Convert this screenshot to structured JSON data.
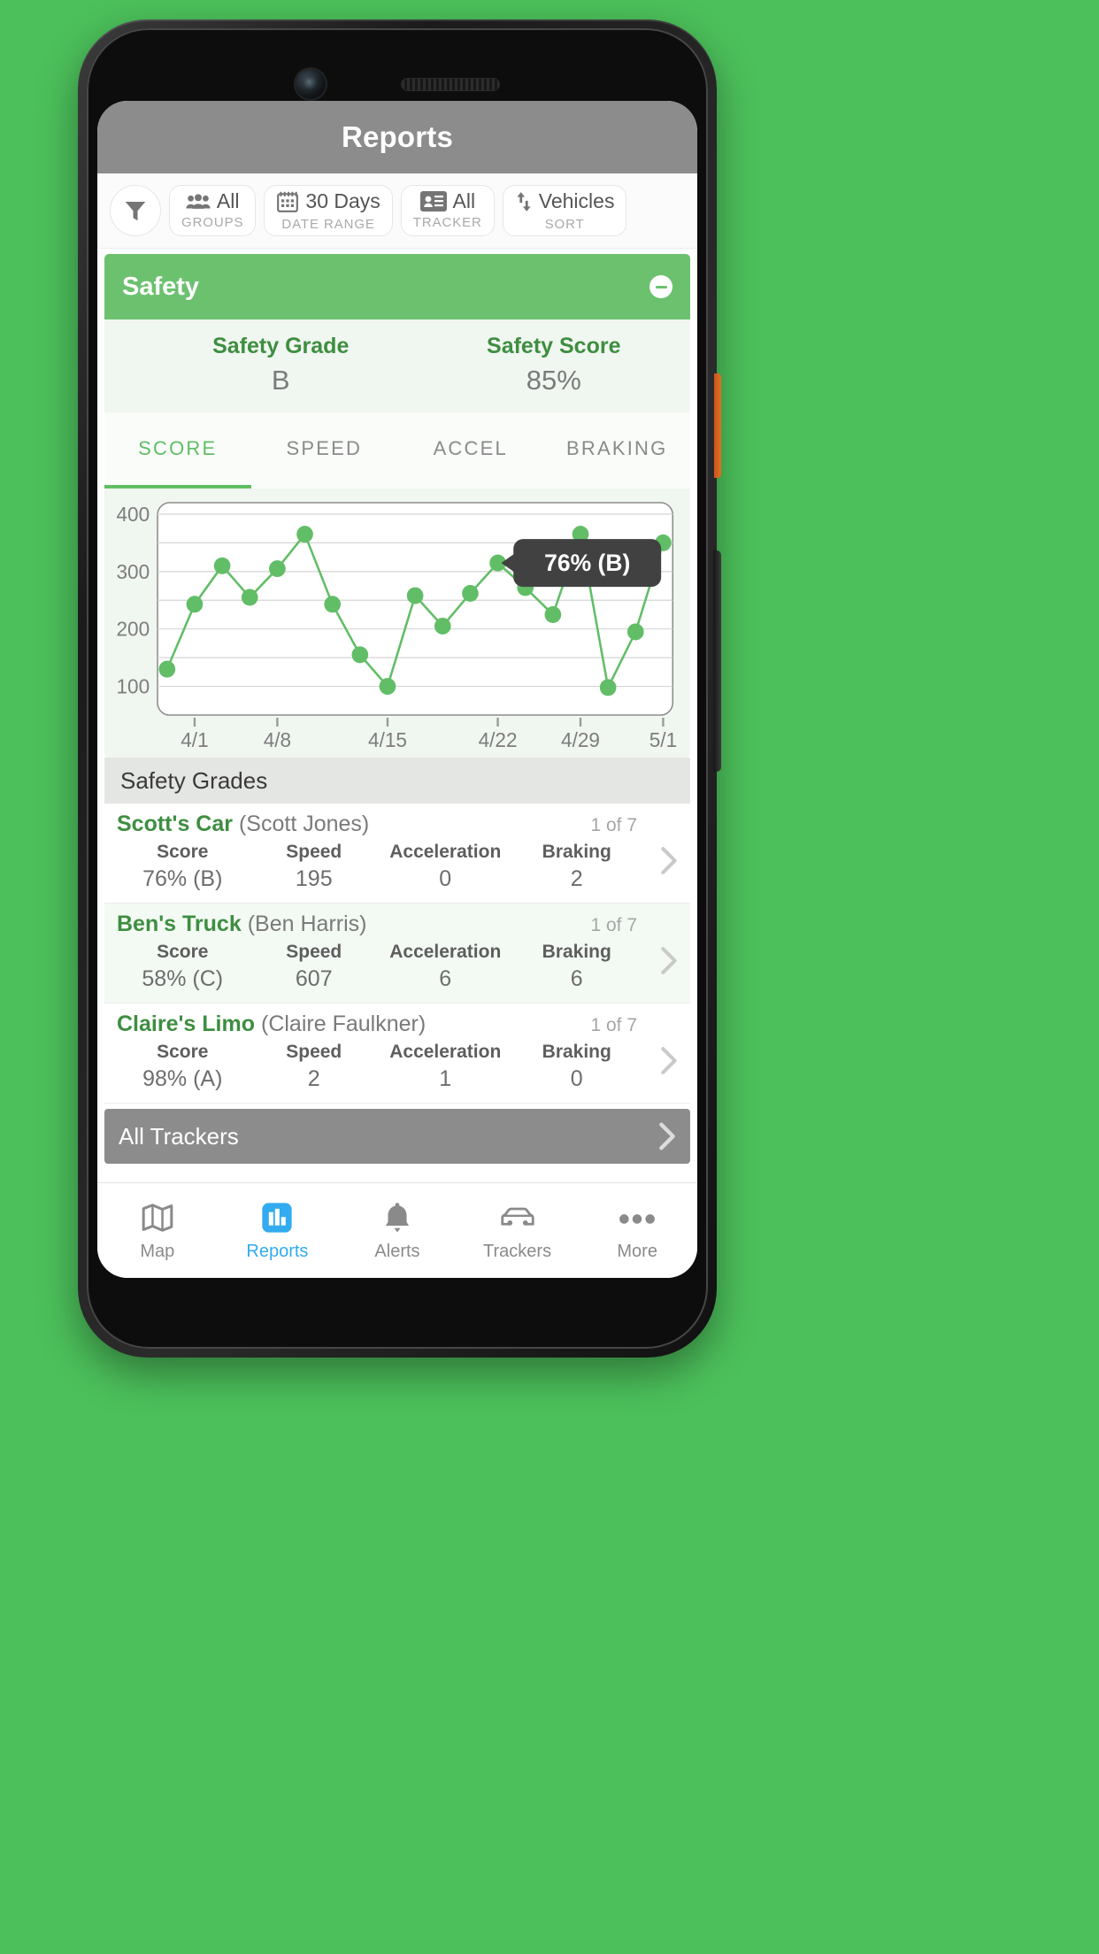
{
  "header": {
    "title": "Reports"
  },
  "filter_bar": {
    "filter_icon": "funnel-icon",
    "chips": [
      {
        "icon": "group-people-icon",
        "value": "All",
        "label": "GROUPS"
      },
      {
        "icon": "calendar-icon",
        "value": "30 Days",
        "label": "DATE RANGE"
      },
      {
        "icon": "id-card-icon",
        "value": "All",
        "label": "TRACKER"
      },
      {
        "icon": "sort-arrows-icon",
        "value": "Vehicles",
        "label": "SORT"
      }
    ]
  },
  "safety_card": {
    "title": "Safety",
    "collapse_icon": "minus-circle-icon",
    "summary": [
      {
        "label": "Safety Grade",
        "value": "B"
      },
      {
        "label": "Safety Score",
        "value": "85%"
      }
    ],
    "tabs": [
      {
        "label": "SCORE",
        "active": true
      },
      {
        "label": "SPEED",
        "active": false
      },
      {
        "label": "ACCEL",
        "active": false
      },
      {
        "label": "BRAKING",
        "active": false
      }
    ]
  },
  "chart_data": {
    "type": "line",
    "title": "",
    "xlabel": "",
    "ylabel": "",
    "grid": true,
    "legend": "none",
    "ylim": [
      50,
      420
    ],
    "yticks": [
      100,
      200,
      300,
      400
    ],
    "ytick_labels": [
      "100",
      "200",
      "300",
      "400"
    ],
    "gridlines": [
      100,
      150,
      200,
      250,
      300,
      350,
      400
    ],
    "xtick_labels": [
      "4/1",
      "4/8",
      "4/15",
      "4/22",
      "4/29",
      "5/1"
    ],
    "xtick_positions": [
      1,
      4,
      8,
      12,
      15,
      18
    ],
    "series": [
      {
        "name": "Safety Score",
        "color": "#62BD67",
        "values": [
          130,
          243,
          310,
          255,
          305,
          365,
          243,
          155,
          100,
          258,
          205,
          262,
          315,
          272,
          225,
          365,
          98,
          195,
          350
        ]
      }
    ],
    "tooltip": {
      "text": "76% (B)",
      "point_index": 12,
      "background": "#414141",
      "text_color": "#ffffff"
    }
  },
  "grades_section": {
    "header": "Safety Grades",
    "columns": [
      "Score",
      "Speed",
      "Acceleration",
      "Braking"
    ],
    "rows": [
      {
        "vehicle": "Scott's Car",
        "owner": "(Scott Jones)",
        "count": "1 of 7",
        "score": "76% (B)",
        "speed": "195",
        "acceleration": "0",
        "braking": "2",
        "highlight": false
      },
      {
        "vehicle": "Ben's Truck",
        "owner": "(Ben Harris)",
        "count": "1 of 7",
        "score": "58% (C)",
        "speed": "607",
        "acceleration": "6",
        "braking": "6",
        "highlight": true
      },
      {
        "vehicle": "Claire's Limo",
        "owner": "(Claire Faulkner)",
        "count": "1 of 7",
        "score": "98% (A)",
        "speed": "2",
        "acceleration": "1",
        "braking": "0",
        "highlight": false
      }
    ]
  },
  "all_trackers": {
    "label": "All Trackers",
    "chevron": "chevron-right-icon"
  },
  "tabbar": {
    "items": [
      {
        "icon": "map-icon",
        "label": "Map",
        "active": false
      },
      {
        "icon": "bar-chart-icon",
        "label": "Reports",
        "active": true
      },
      {
        "icon": "bell-icon",
        "label": "Alerts",
        "active": false
      },
      {
        "icon": "car-icon",
        "label": "Trackers",
        "active": false
      },
      {
        "icon": "ellipsis-icon",
        "label": "More",
        "active": false
      }
    ]
  },
  "colors": {
    "accent_green": "#6CC16F",
    "dark_green_text": "#3E8E41",
    "active_blue": "#32ABF0",
    "background_green": "#4CC05B",
    "navbar_gray": "#8c8c8c"
  }
}
